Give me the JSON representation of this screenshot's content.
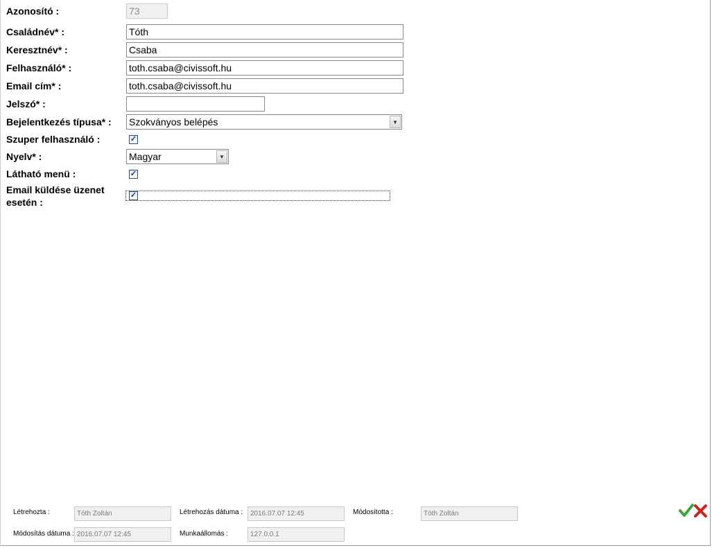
{
  "form": {
    "id": {
      "label": "Azonosító :",
      "value": "73"
    },
    "last_name": {
      "label": "Családnév* :",
      "value": "Tóth"
    },
    "first_name": {
      "label": "Keresztnév* :",
      "value": "Csaba"
    },
    "username": {
      "label": "Felhasználó* :",
      "value": "toth.csaba@civissoft.hu"
    },
    "email": {
      "label": "Email cím* :",
      "value": "toth.csaba@civissoft.hu"
    },
    "password": {
      "label": "Jelszó* :",
      "value": ""
    },
    "login_type": {
      "label": "Bejelentkezés típusa* :",
      "value": "Szokványos belépés"
    },
    "super_user": {
      "label": "Szuper felhasználó :",
      "checked": true
    },
    "language": {
      "label": "Nyelv* :",
      "value": "Magyar"
    },
    "visible_menu": {
      "label": "Látható menü :",
      "checked": true
    },
    "email_on_message": {
      "label_line1": "Email küldése üzenet",
      "label_line2": "esetén :",
      "checked": true
    }
  },
  "footer": {
    "created_by": {
      "label": "Létrehozta :",
      "value": "Tóth Zoltán"
    },
    "created_date": {
      "label": "Létrehozás dátuma :",
      "value": "2016.07.07 12:45"
    },
    "modified_by": {
      "label": "Módosította :",
      "value": "Tóth Zoltán"
    },
    "modified_date": {
      "label": "Módosítás dátuma :",
      "value": "2016.07.07 12:45"
    },
    "workstation": {
      "label": "Munkaállomás :",
      "value": "127.0.0.1"
    }
  },
  "actions": {
    "confirm_icon": "checkmark-icon",
    "cancel_icon": "cross-icon",
    "confirm_color": "#3aa53a",
    "cancel_color": "#d11f1f"
  }
}
